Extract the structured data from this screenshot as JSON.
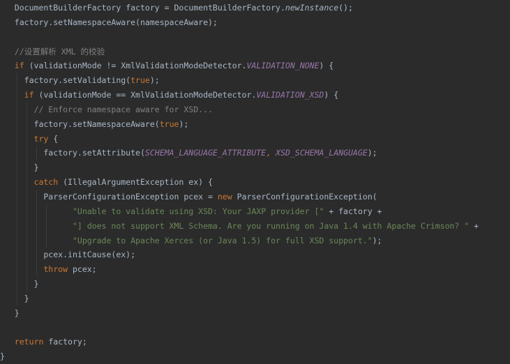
{
  "editor": {
    "theme": "darcula",
    "colors": {
      "background": "#2b2b2b",
      "default": "#a9b7c6",
      "keyword": "#cc7832",
      "string": "#6a8759",
      "comment": "#808080",
      "constant": "#9876aa"
    },
    "lines": [
      {
        "indent": "   ",
        "tokens": [
          {
            "t": "DocumentBuilderFactory factory = DocumentBuilderFactory.",
            "c": "ident"
          },
          {
            "t": "newInstance",
            "c": "static"
          },
          {
            "t": "();",
            "c": "ident"
          }
        ]
      },
      {
        "indent": "   ",
        "tokens": [
          {
            "t": "factory.setNamespaceAware(namespaceAware);",
            "c": "ident"
          }
        ]
      },
      {
        "indent": "",
        "tokens": []
      },
      {
        "indent": "   ",
        "tokens": [
          {
            "t": "//设置解析 XML 的校验",
            "c": "cmt"
          }
        ]
      },
      {
        "indent": "   ",
        "tokens": [
          {
            "t": "if",
            "c": "kw"
          },
          {
            "t": " (validationMode != XmlValidationModeDetector.",
            "c": "ident"
          },
          {
            "t": "VALIDATION_NONE",
            "c": "const"
          },
          {
            "t": ") {",
            "c": "ident"
          }
        ]
      },
      {
        "indent": "     ",
        "tokens": [
          {
            "t": "factory.setValidating(",
            "c": "ident"
          },
          {
            "t": "true",
            "c": "kw"
          },
          {
            "t": ");",
            "c": "ident"
          }
        ]
      },
      {
        "indent": "     ",
        "tokens": [
          {
            "t": "if",
            "c": "kw"
          },
          {
            "t": " (validationMode == XmlValidationModeDetector.",
            "c": "ident"
          },
          {
            "t": "VALIDATION_XSD",
            "c": "const"
          },
          {
            "t": ") {",
            "c": "ident"
          }
        ]
      },
      {
        "indent": "       ",
        "tokens": [
          {
            "t": "// Enforce namespace aware for XSD...",
            "c": "cmt"
          }
        ]
      },
      {
        "indent": "       ",
        "tokens": [
          {
            "t": "factory.setNamespaceAware(",
            "c": "ident"
          },
          {
            "t": "true",
            "c": "kw"
          },
          {
            "t": ");",
            "c": "ident"
          }
        ]
      },
      {
        "indent": "       ",
        "tokens": [
          {
            "t": "try",
            "c": "kw"
          },
          {
            "t": " {",
            "c": "ident"
          }
        ]
      },
      {
        "indent": "         ",
        "tokens": [
          {
            "t": "factory.setAttribute(",
            "c": "ident"
          },
          {
            "t": "SCHEMA_LANGUAGE_ATTRIBUTE",
            "c": "const"
          },
          {
            "t": ", ",
            "c": "kw"
          },
          {
            "t": "XSD_SCHEMA_LANGUAGE",
            "c": "const"
          },
          {
            "t": ");",
            "c": "ident"
          }
        ]
      },
      {
        "indent": "       ",
        "tokens": [
          {
            "t": "}",
            "c": "ident"
          }
        ]
      },
      {
        "indent": "       ",
        "tokens": [
          {
            "t": "catch",
            "c": "kw"
          },
          {
            "t": " (IllegalArgumentException ex) {",
            "c": "ident"
          }
        ]
      },
      {
        "indent": "         ",
        "tokens": [
          {
            "t": "ParserConfigurationException pcex = ",
            "c": "ident"
          },
          {
            "t": "new",
            "c": "kw"
          },
          {
            "t": " ParserConfigurationException(",
            "c": "ident"
          }
        ]
      },
      {
        "indent": "               ",
        "tokens": [
          {
            "t": "\"Unable to validate using XSD: Your JAXP provider [\"",
            "c": "str"
          },
          {
            "t": " + factory +",
            "c": "ident"
          }
        ]
      },
      {
        "indent": "               ",
        "tokens": [
          {
            "t": "\"] does not support XML Schema. Are you running on Java 1.4 with Apache Crimson? \"",
            "c": "str"
          },
          {
            "t": " +",
            "c": "ident"
          }
        ]
      },
      {
        "indent": "               ",
        "tokens": [
          {
            "t": "\"Upgrade to Apache Xerces (or Java 1.5) for full XSD support.\"",
            "c": "str"
          },
          {
            "t": ");",
            "c": "ident"
          }
        ]
      },
      {
        "indent": "         ",
        "tokens": [
          {
            "t": "pcex.initCause(ex);",
            "c": "ident"
          }
        ]
      },
      {
        "indent": "         ",
        "tokens": [
          {
            "t": "throw",
            "c": "kw"
          },
          {
            "t": " pcex;",
            "c": "ident"
          }
        ]
      },
      {
        "indent": "       ",
        "tokens": [
          {
            "t": "}",
            "c": "ident"
          }
        ]
      },
      {
        "indent": "     ",
        "tokens": [
          {
            "t": "}",
            "c": "ident"
          }
        ]
      },
      {
        "indent": "   ",
        "tokens": [
          {
            "t": "}",
            "c": "ident"
          }
        ]
      },
      {
        "indent": "",
        "tokens": []
      },
      {
        "indent": "   ",
        "tokens": [
          {
            "t": "return",
            "c": "kw"
          },
          {
            "t": " factory;",
            "c": "ident"
          }
        ]
      },
      {
        "indent": "",
        "tokens": [
          {
            "t": "}",
            "c": "ident"
          }
        ]
      }
    ]
  }
}
